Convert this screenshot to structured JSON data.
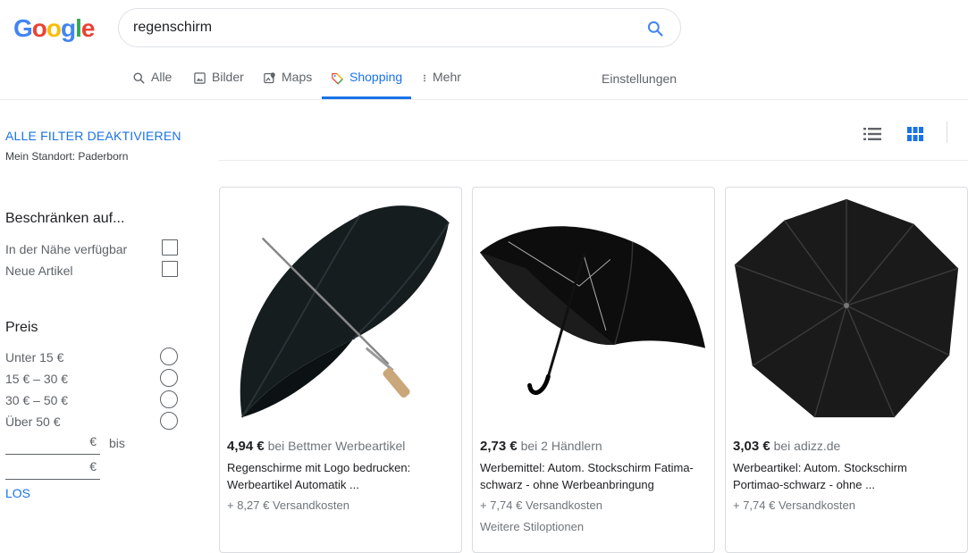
{
  "header": {
    "logo_letters": [
      "G",
      "o",
      "o",
      "g",
      "l",
      "e"
    ],
    "search_value": "regenschirm"
  },
  "tabs": [
    {
      "label": "Alle",
      "icon": "search-icon"
    },
    {
      "label": "Bilder",
      "icon": "image-icon"
    },
    {
      "label": "Maps",
      "icon": "map-icon"
    },
    {
      "label": "Shopping",
      "icon": "tag-icon",
      "active": true
    },
    {
      "label": "Mehr",
      "icon": "more-vert-icon"
    }
  ],
  "settings_label": "Einstellungen",
  "sidebar": {
    "clear_filters": "ALLE FILTER DEAKTIVIEREN",
    "location": "Mein Standort: Paderborn",
    "restrict_heading": "Beschränken auf...",
    "restrict_items": [
      "In der Nähe verfügbar",
      "Neue Artikel"
    ],
    "price_heading": "Preis",
    "price_items": [
      "Unter 15 €",
      "15 € – 30 €",
      "30 € – 50 €",
      "Über 50 €"
    ],
    "currency": "€",
    "to_label": "bis",
    "go_label": "LOS"
  },
  "products": [
    {
      "price": "4,94 €",
      "seller": "bei Bettmer Werbeartikel",
      "title_line1": "Regenschirme mit Logo bedrucken:",
      "title_line2": "Werbeartikel Automatik ...",
      "shipping": "+ 8,27 € Versandkosten",
      "extra": ""
    },
    {
      "price": "2,73 €",
      "seller": "bei 2 Händlern",
      "title_line1": "Werbemittel: Autom. Stockschirm Fatima-",
      "title_line2": "schwarz - ohne Werbeanbringung",
      "shipping": "+ 7,74 € Versandkosten",
      "extra": "Weitere Stiloptionen"
    },
    {
      "price": "3,03 €",
      "seller": "bei adizz.de",
      "title_line1": "Werbeartikel: Autom. Stockschirm",
      "title_line2": "Portimao-schwarz - ohne ...",
      "shipping": "+ 7,74 € Versandkosten",
      "extra": ""
    }
  ],
  "colors": {
    "accent": "#1a73e8",
    "text": "#202124",
    "muted": "#70757a"
  }
}
